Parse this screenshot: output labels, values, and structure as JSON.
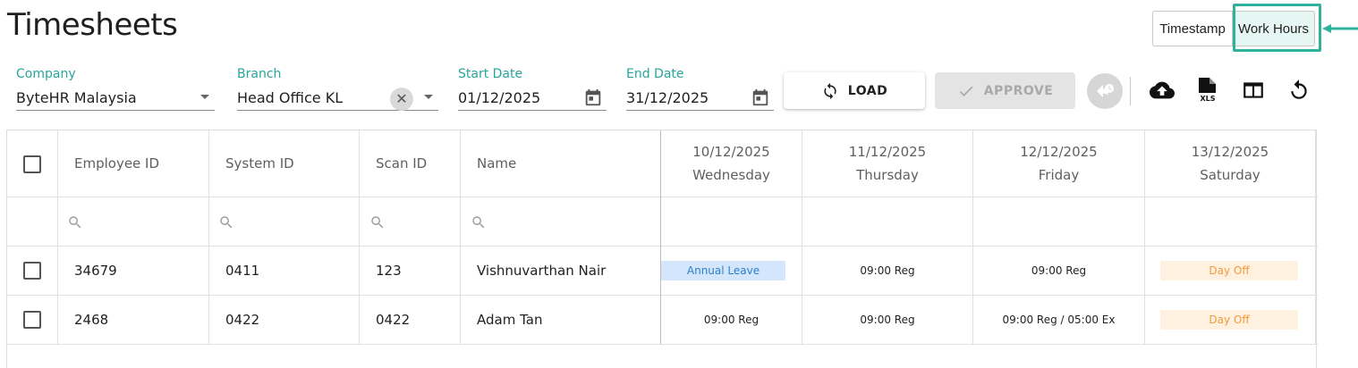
{
  "page": {
    "title": "Timesheets"
  },
  "view_toggle": {
    "timestamp_label": "Timestamp",
    "work_hours_label": "Work Hours",
    "active": "Work Hours"
  },
  "filters": {
    "company": {
      "label": "Company",
      "value": "ByteHR Malaysia"
    },
    "branch": {
      "label": "Branch",
      "value": "Head Office KL"
    },
    "start_date": {
      "label": "Start Date",
      "value": "01/12/2025"
    },
    "end_date": {
      "label": "End Date",
      "value": "31/12/2025"
    }
  },
  "actions": {
    "load_label": "LOAD",
    "approve_label": "APPROVE",
    "approve_disabled": true
  },
  "toolbar_icons": [
    "revert-history-icon",
    "cloud-upload-icon",
    "xls-export-icon",
    "columns-icon",
    "refresh-icon"
  ],
  "table": {
    "columns": {
      "employee_id": "Employee ID",
      "system_id": "System ID",
      "scan_id": "Scan ID",
      "name": "Name"
    },
    "dates": [
      {
        "date": "10/12/2025",
        "day": "Wednesday"
      },
      {
        "date": "11/12/2025",
        "day": "Thursday"
      },
      {
        "date": "12/12/2025",
        "day": "Friday"
      },
      {
        "date": "13/12/2025",
        "day": "Saturday"
      }
    ],
    "rows": [
      {
        "employee_id": "34679",
        "system_id": "0411",
        "scan_id": "123",
        "name": "Vishnuvarthan Nair",
        "cells": [
          "Annual Leave",
          "09:00 Reg",
          "09:00 Reg",
          "Day Off"
        ]
      },
      {
        "employee_id": "2468",
        "system_id": "0422",
        "scan_id": "0422",
        "name": "Adam Tan",
        "cells": [
          "09:00 Reg",
          "09:00 Reg",
          "09:00 Reg / 05:00 Ex",
          "Day Off"
        ]
      }
    ]
  },
  "colors": {
    "accent": "#26a69a",
    "highlight": "#2fb19b",
    "leave_bg": "#d3e6fb",
    "leave_text": "#2d7fc9",
    "off_bg": "#fff1e0",
    "off_text": "#f29a3b"
  }
}
